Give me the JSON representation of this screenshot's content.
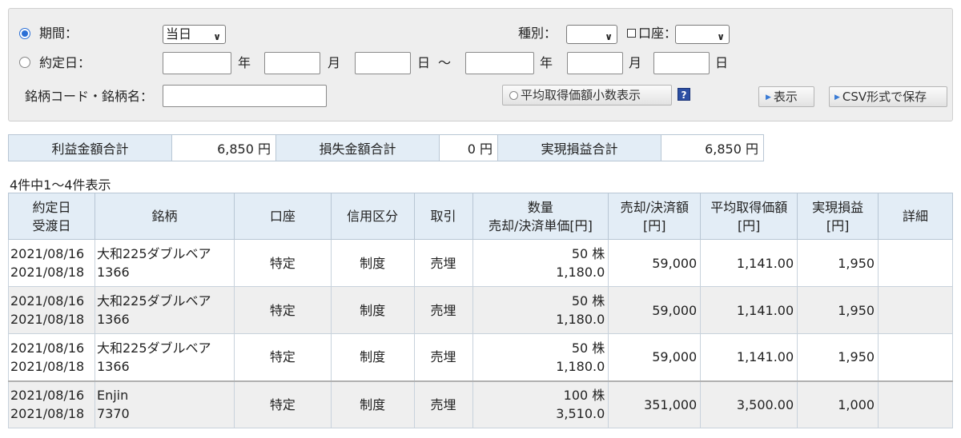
{
  "search": {
    "period_label": "期間：",
    "period_select": "当日",
    "type_label": "種別：",
    "type_select": "",
    "account_label": "口座：",
    "account_select": "",
    "contract_date_label": "約定日：",
    "year_label": "年",
    "month_label": "月",
    "day_label": "日",
    "range_sep": "～",
    "stock_label": "銘柄コード・銘柄名：",
    "avg_decimal_button": "平均取得価額小数表示",
    "help_icon_text": "?",
    "show_button": "表示",
    "csv_button": "CSV形式で保存"
  },
  "summary": {
    "profit_label": "利益金額合計",
    "profit_value": "6,850 円",
    "loss_label": "損失金額合計",
    "loss_value": "0 円",
    "realized_label": "実現損益合計",
    "realized_value": "6,850 円"
  },
  "count_text": "4件中1～4件表示",
  "table": {
    "headers": {
      "date1": "約定日",
      "date2": "受渡日",
      "stock": "銘柄",
      "account": "口座",
      "credit": "信用区分",
      "trade": "取引",
      "qty1": "数量",
      "qty2": "売却/決済単価[円]",
      "sale1": "売却/決済額",
      "sale2": "[円]",
      "avg1": "平均取得価額",
      "avg2": "[円]",
      "pl1": "実現損益",
      "pl2": "[円]",
      "detail": "詳細"
    },
    "rows": [
      {
        "contract_date": "2021/08/16",
        "settle_date": "2021/08/18",
        "name": "大和225ダブルベア",
        "code": "1366",
        "account": "特定",
        "credit": "制度",
        "trade": "売埋",
        "qty": "50 株",
        "price": "1,180.0",
        "amount": "59,000",
        "avg_price": "1,141.00",
        "pl": "1,950",
        "detail": ""
      },
      {
        "contract_date": "2021/08/16",
        "settle_date": "2021/08/18",
        "name": "大和225ダブルベア",
        "code": "1366",
        "account": "特定",
        "credit": "制度",
        "trade": "売埋",
        "qty": "50 株",
        "price": "1,180.0",
        "amount": "59,000",
        "avg_price": "1,141.00",
        "pl": "1,950",
        "detail": ""
      },
      {
        "contract_date": "2021/08/16",
        "settle_date": "2021/08/18",
        "name": "大和225ダブルベア",
        "code": "1366",
        "account": "特定",
        "credit": "制度",
        "trade": "売埋",
        "qty": "50 株",
        "price": "1,180.0",
        "amount": "59,000",
        "avg_price": "1,141.00",
        "pl": "1,950",
        "detail": ""
      },
      {
        "contract_date": "2021/08/16",
        "settle_date": "2021/08/18",
        "name": "Enjin",
        "code": "7370",
        "account": "特定",
        "credit": "制度",
        "trade": "売埋",
        "qty": "100 株",
        "price": "3,510.0",
        "amount": "351,000",
        "avg_price": "3,500.00",
        "pl": "1,000",
        "detail": ""
      }
    ]
  },
  "colors": {
    "header_bg": "#e3edf6",
    "radio_accent": "#2a6fd6",
    "alt_row_bg": "#efefef"
  }
}
